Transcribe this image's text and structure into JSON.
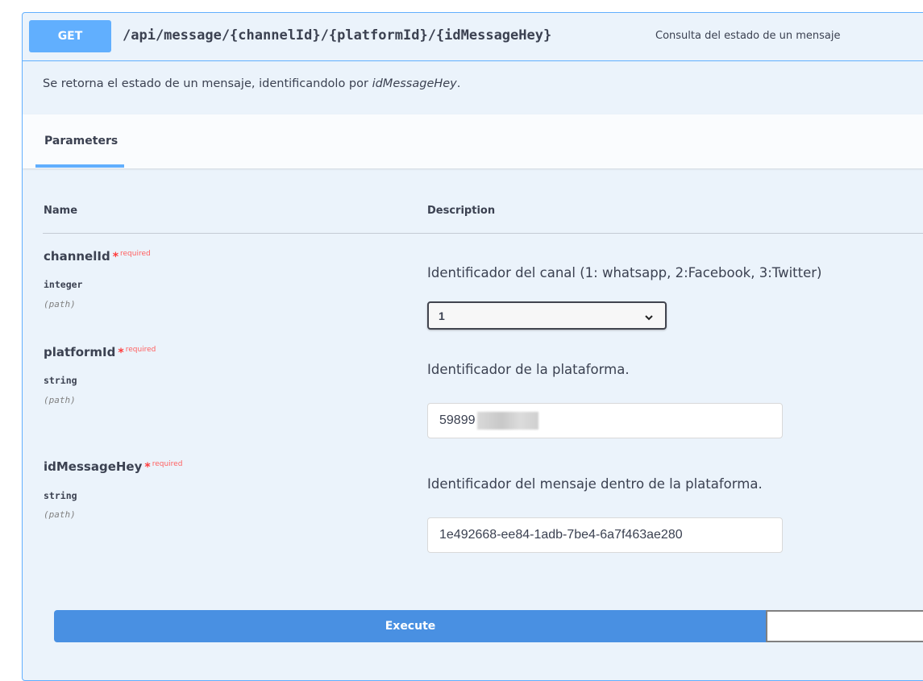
{
  "operation": {
    "method": "GET",
    "path": "/api/message/{channelId}/{platformId}/{idMessageHey}",
    "summary": "Consulta del estado de un mensaje",
    "description_prefix": "Se retorna el estado de un mensaje, identificandolo por ",
    "description_em": "idMessageHey",
    "description_suffix": "."
  },
  "tabs": {
    "parameters_label": "Parameters"
  },
  "table": {
    "col_name": "Name",
    "col_description": "Description"
  },
  "params": [
    {
      "name": "channelId",
      "star": "*",
      "required_label": "required",
      "type": "integer",
      "in": "(path)",
      "description": "Identificador del canal (1: whatsapp, 2:Facebook, 3:Twitter)",
      "selected_value": "1"
    },
    {
      "name": "platformId",
      "star": "*",
      "required_label": "required",
      "type": "string",
      "in": "(path)",
      "description": "Identificador de la plataforma.",
      "value": "59899"
    },
    {
      "name": "idMessageHey",
      "star": "*",
      "required_label": "required",
      "type": "string",
      "in": "(path)",
      "description": "Identificador del mensaje dentro de la plataforma.",
      "value": "1e492668-ee84-1adb-7be4-6a7f463ae280"
    }
  ],
  "actions": {
    "execute_label": "Execute",
    "clear_label": ""
  },
  "colors": {
    "get_accent": "#61affe",
    "execute_blue": "#4990e2",
    "block_bg": "#ebf3fb",
    "required_red": "#ff3b3b"
  },
  "icons": {
    "select_arrow": "chevron-down-icon"
  }
}
